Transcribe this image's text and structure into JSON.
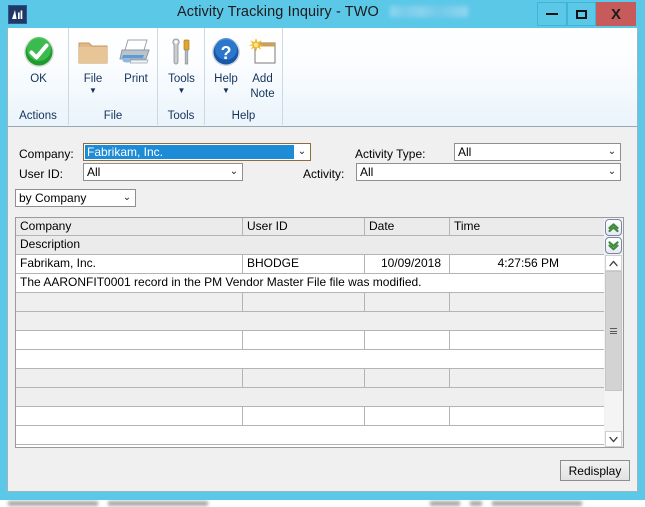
{
  "window": {
    "title_main": "Activity Tracking Inquiry",
    "title_sep": "-",
    "title_company": "TWO",
    "app_icon": "dynamics-gp-icon",
    "titlebar_color": "#5cc8e8",
    "close_color": "#c75b5b",
    "minimize_label": "Minimize",
    "maximize_label": "Maximize",
    "close_label": "X"
  },
  "ribbon": {
    "groups": [
      {
        "label": "Actions"
      },
      {
        "label": "File"
      },
      {
        "label": "Tools"
      },
      {
        "label": "Help"
      }
    ],
    "items": {
      "ok": {
        "label": "OK",
        "icon": "ok-checkmark-icon"
      },
      "file": {
        "label": "File",
        "icon": "folder-icon",
        "caret": "▼"
      },
      "print": {
        "label": "Print",
        "icon": "printer-icon"
      },
      "tools": {
        "label": "Tools",
        "icon": "wrench-screwdriver-icon",
        "caret": "▼"
      },
      "help": {
        "label": "Help",
        "icon": "question-mark-icon",
        "caret": "▼"
      },
      "add_note": {
        "label_line1": "Add",
        "label_line2": "Note",
        "icon": "add-note-icon"
      }
    }
  },
  "filters": {
    "company": {
      "label": "Company:",
      "value": "Fabrikam, Inc.",
      "focused": true
    },
    "user_id": {
      "label": "User ID:",
      "value": "All"
    },
    "activity_type": {
      "label": "Activity Type:",
      "value": "All"
    },
    "activity": {
      "label": "Activity:",
      "value": "All"
    },
    "sort_by": {
      "value": "by Company"
    },
    "dropdown_arrow": "⌄"
  },
  "grid": {
    "columns": [
      "Company",
      "User ID",
      "Date",
      "Time"
    ],
    "description_header": "Description",
    "rows": [
      {
        "company": "Fabrikam, Inc.",
        "user_id": "BHODGE",
        "date": "10/09/2018",
        "time": "4:27:56 PM",
        "description": "The AARONFIT0001 record in the PM Vendor Master File file was modified."
      }
    ],
    "empty_row_count": 4,
    "nav_up_icon": "double-chevron-up-icon",
    "nav_down_icon": "double-chevron-down-icon",
    "scroll_up_icon": "chevron-up-icon",
    "scroll_down_icon": "chevron-down-icon"
  },
  "footer": {
    "redisplay_label": "Redisplay"
  }
}
